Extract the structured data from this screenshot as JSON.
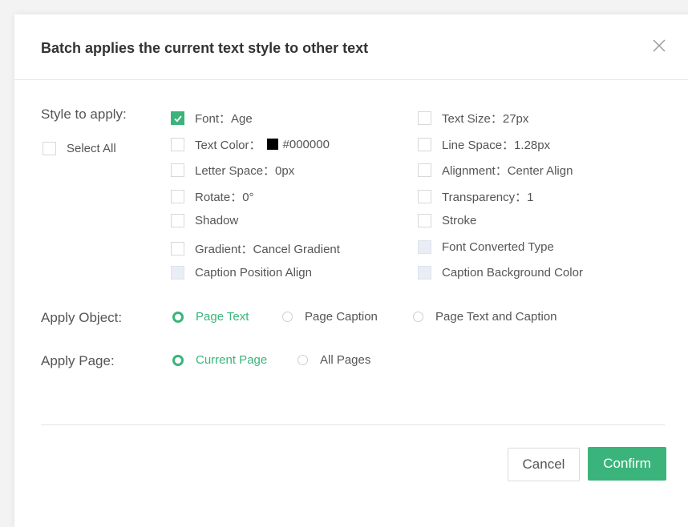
{
  "dialog": {
    "title": "Batch applies the current text style to other text"
  },
  "style_section": {
    "label": "Style to apply:",
    "select_all": {
      "label": "Select All",
      "checked": false
    },
    "left_column": [
      {
        "label": "Font：Age",
        "checked": true,
        "state": "checked"
      },
      {
        "label": "Text Color：",
        "value": "#000000",
        "checked": false,
        "state": "normal",
        "swatch_color": "#000000"
      },
      {
        "label": "Letter Space：0px",
        "checked": false,
        "state": "normal"
      },
      {
        "label": "Rotate：0°",
        "checked": false,
        "state": "normal"
      },
      {
        "label": "Shadow",
        "checked": false,
        "state": "normal"
      },
      {
        "label": "Gradient：Cancel Gradient",
        "checked": false,
        "state": "normal"
      },
      {
        "label": "Caption Position Align",
        "checked": false,
        "state": "disabled"
      }
    ],
    "right_column": [
      {
        "label": "Text Size：27px",
        "checked": false,
        "state": "normal"
      },
      {
        "label": "Line Space：1.28px",
        "checked": false,
        "state": "normal"
      },
      {
        "label": "Alignment：Center Align",
        "checked": false,
        "state": "normal"
      },
      {
        "label": "Transparency：1",
        "checked": false,
        "state": "normal"
      },
      {
        "label": "Stroke",
        "checked": false,
        "state": "normal"
      },
      {
        "label": "Font Converted Type",
        "checked": false,
        "state": "disabled"
      },
      {
        "label": "Caption Background Color",
        "checked": false,
        "state": "disabled"
      }
    ]
  },
  "apply_object": {
    "label": "Apply Object:",
    "options": [
      "Page Text",
      "Page Caption",
      "Page Text and Caption"
    ],
    "selected": "Page Text"
  },
  "apply_page": {
    "label": "Apply Page:",
    "options": [
      "Current Page",
      "All Pages"
    ],
    "selected": "Current Page"
  },
  "footer": {
    "cancel_label": "Cancel",
    "confirm_label": "Confirm"
  },
  "colors": {
    "accent": "#3ab47a",
    "disabled_checkbox": "#e9edf5"
  }
}
